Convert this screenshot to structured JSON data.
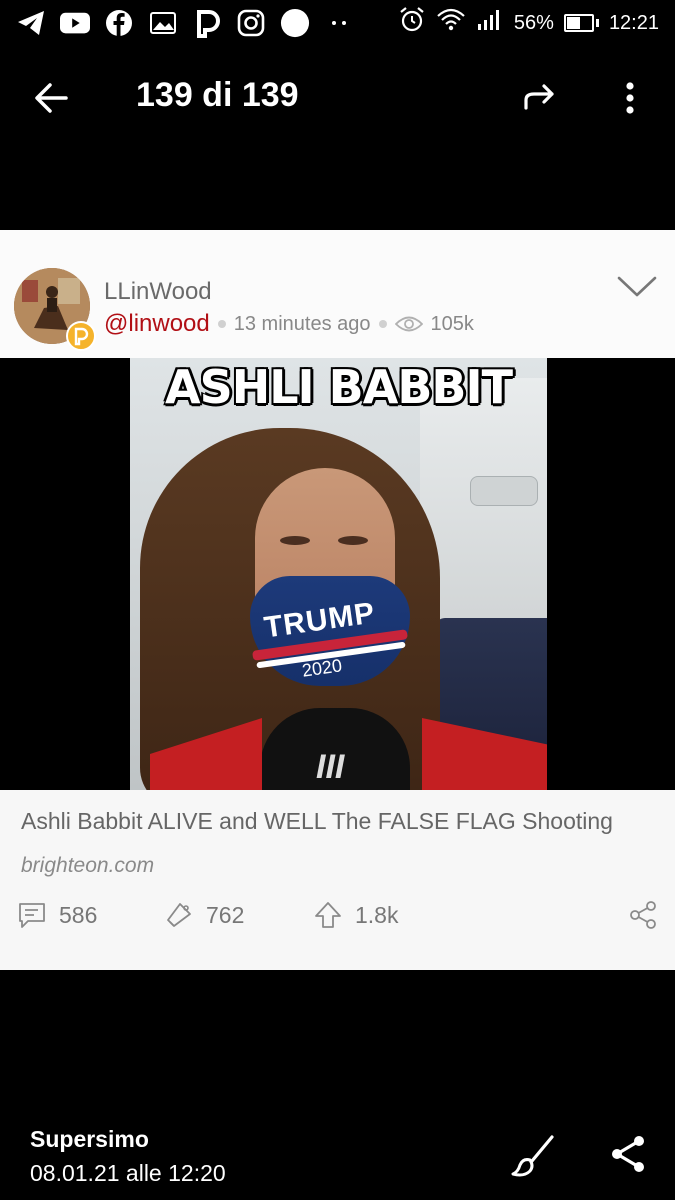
{
  "status_bar": {
    "battery_percent": "56%",
    "battery_level": 0.56,
    "time": "12:21",
    "icons": [
      "telegram-icon",
      "youtube-icon",
      "facebook-icon",
      "gallery-icon",
      "parler-icon",
      "instagram-icon",
      "circle-app-icon",
      "more-dots-icon",
      "alarm-icon",
      "wifi-icon",
      "signal-icon",
      "battery-icon"
    ]
  },
  "viewer": {
    "counter": "139 di 139"
  },
  "post": {
    "display_name": "LLinWood",
    "handle": "@linwood",
    "time_ago": "13 minutes ago",
    "views": "105k",
    "image_caption": "ASHLI BABBIT",
    "mask_text": "TRUMP",
    "mask_year": "2020",
    "link_title": "Ashli Babbit ALIVE and WELL The FALSE FLAG Shooting",
    "link_domain": "brighteon.com",
    "comments": "586",
    "reposts": "762",
    "upvotes": "1.8k"
  },
  "footer": {
    "author": "Supersimo",
    "date": "08.01.21 alle 12:20"
  },
  "colors": {
    "background": "#000000",
    "card": "#f7f7f7",
    "handle": "#b10f15",
    "badge": "#f5b32b"
  }
}
